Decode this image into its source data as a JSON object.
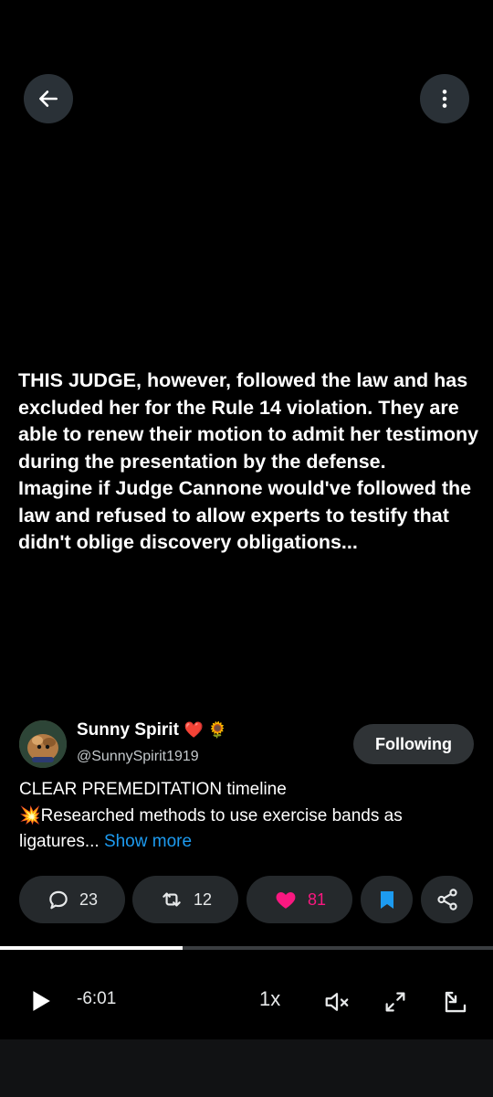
{
  "video": {
    "text": "THIS JUDGE, however, followed the law and has excluded her for the Rule 14 violation. They are able to renew their motion to admit her testimony during the presentation by the defense.\nImagine if Judge Cannone would've followed the law and refused to allow experts to testify that didn't oblige discovery obligations..."
  },
  "author": {
    "name": "Sunny Spirit",
    "name_emojis": "❤️ 🌻",
    "handle": "@SunnySpirit1919",
    "follow_label": "Following"
  },
  "post": {
    "line1": "CLEAR PREMEDITATION timeline",
    "line2": "💥Researched methods to use exercise bands as",
    "line3": "ligatures...",
    "show_more": "Show more"
  },
  "actions": {
    "replies": "23",
    "reposts": "12",
    "likes": "81",
    "liked": true,
    "bookmarked": true
  },
  "player": {
    "time_remaining": "-6:01",
    "speed": "1x",
    "progress": 0.37
  },
  "colors": {
    "accent": "#1d9bf0",
    "like": "#f91880",
    "pill_bg": "#25292c"
  },
  "icons": [
    "back-arrow-icon",
    "more-vertical-icon",
    "reply-icon",
    "retweet-icon",
    "heart-icon",
    "bookmark-icon",
    "share-icon",
    "play-icon",
    "mute-icon",
    "fullscreen-icon",
    "pip-icon"
  ]
}
